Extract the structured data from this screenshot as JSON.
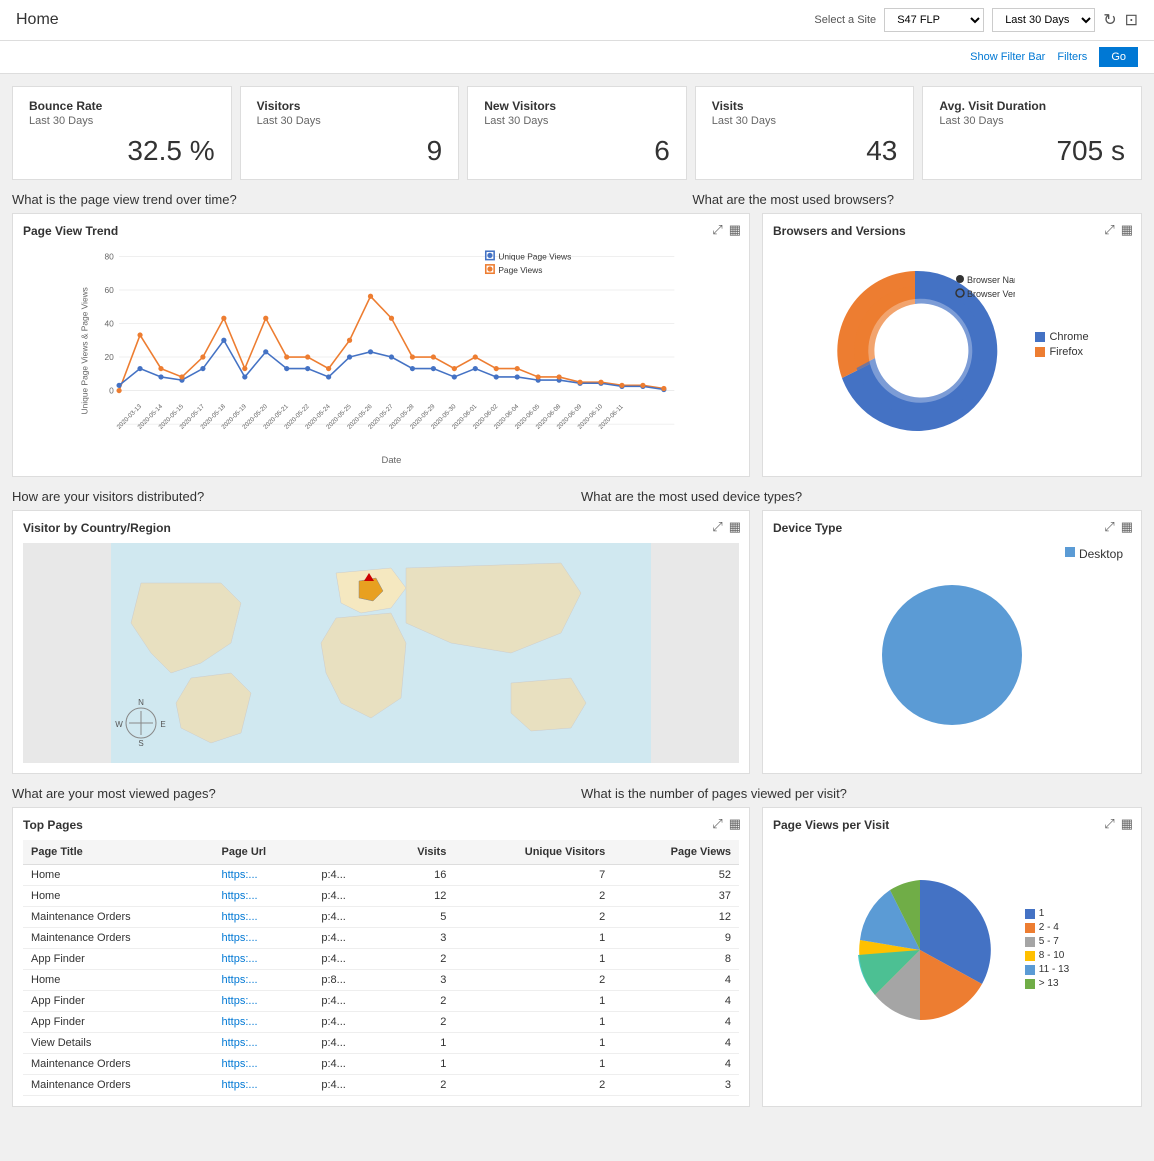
{
  "header": {
    "title": "Home",
    "site_label": "Select a Site",
    "site_value": "S47 FLP",
    "period_value": "Last 30 Days",
    "refresh_icon": "↻",
    "camera_icon": "📷"
  },
  "filter_bar": {
    "show_filter_bar_label": "Show Filter Bar",
    "filters_label": "Filters",
    "go_label": "Go"
  },
  "stats": [
    {
      "title": "Bounce Rate",
      "subtitle": "Last 30 Days",
      "value": "32.5 %"
    },
    {
      "title": "Visitors",
      "subtitle": "Last 30 Days",
      "value": "9"
    },
    {
      "title": "New Visitors",
      "subtitle": "Last 30 Days",
      "value": "6"
    },
    {
      "title": "Visits",
      "subtitle": "Last 30 Days",
      "value": "43"
    },
    {
      "title": "Avg. Visit Duration",
      "subtitle": "Last 30 Days",
      "value": "705 s"
    }
  ],
  "sections": {
    "page_view_question": "What is the page view trend over time?",
    "browsers_question": "What are the most used browsers?",
    "visitors_dist_question": "How are your visitors distributed?",
    "device_type_question": "What are the most used device types?",
    "most_viewed_question": "What are your most viewed pages?",
    "pages_per_visit_question": "What is the number of pages viewed per visit?"
  },
  "page_view_trend": {
    "title": "Page View Trend",
    "y_label": "Unique Page Views & Page Views",
    "x_label": "Date",
    "legend": [
      {
        "label": "Unique Page Views",
        "color": "#4472C4"
      },
      {
        "label": "Page Views",
        "color": "#ED7D31"
      }
    ]
  },
  "browsers": {
    "title": "Browsers and Versions",
    "legend_titles": [
      "Browser Name",
      "Browser Version"
    ],
    "items": [
      {
        "label": "Chrome",
        "color": "#4472C4",
        "value": 65
      },
      {
        "label": "Firefox",
        "color": "#ED7D31",
        "value": 35
      }
    ]
  },
  "map": {
    "title": "Visitor by Country/Region"
  },
  "device_type": {
    "title": "Device Type",
    "items": [
      {
        "label": "Desktop",
        "color": "#5B9BD5",
        "value": 100
      }
    ]
  },
  "top_pages": {
    "title": "Top Pages",
    "columns": [
      "Page Title",
      "Page Url",
      "",
      "Visits",
      "Unique Visitors",
      "Page Views"
    ],
    "rows": [
      {
        "title": "Home",
        "url": "https:...",
        "param": "p:4...",
        "visits": 16,
        "unique": 7,
        "pageviews": 52
      },
      {
        "title": "Home",
        "url": "https:...",
        "param": "p:4...",
        "visits": 12,
        "unique": 2,
        "pageviews": 37
      },
      {
        "title": "Maintenance Orders",
        "url": "https:...",
        "param": "p:4...",
        "visits": 5,
        "unique": 2,
        "pageviews": 12
      },
      {
        "title": "Maintenance Orders",
        "url": "https:...",
        "param": "p:4...",
        "visits": 3,
        "unique": 1,
        "pageviews": 9
      },
      {
        "title": "App Finder",
        "url": "https:...",
        "param": "p:4...",
        "visits": 2,
        "unique": 1,
        "pageviews": 8
      },
      {
        "title": "Home",
        "url": "https:...",
        "param": "p:8...",
        "visits": 3,
        "unique": 2,
        "pageviews": 4
      },
      {
        "title": "App Finder",
        "url": "https:...",
        "param": "p:4...",
        "visits": 2,
        "unique": 1,
        "pageviews": 4
      },
      {
        "title": "App Finder",
        "url": "https:...",
        "param": "p:4...",
        "visits": 2,
        "unique": 1,
        "pageviews": 4
      },
      {
        "title": "View Details",
        "url": "https:...",
        "param": "p:4...",
        "visits": 1,
        "unique": 1,
        "pageviews": 4
      },
      {
        "title": "Maintenance Orders",
        "url": "https:...",
        "param": "p:4...",
        "visits": 1,
        "unique": 1,
        "pageviews": 4
      },
      {
        "title": "Maintenance Orders",
        "url": "https:...",
        "param": "p:4...",
        "visits": 2,
        "unique": 2,
        "pageviews": 3
      }
    ]
  },
  "page_views_per_visit": {
    "title": "Page Views per Visit",
    "legend": [
      {
        "label": "1",
        "color": "#4472C4"
      },
      {
        "label": "2 - 4",
        "color": "#ED7D31"
      },
      {
        "label": "5 - 7",
        "color": "#A5A5A5"
      },
      {
        "label": "8 - 10",
        "color": "#FFC000"
      },
      {
        "label": "11 - 13",
        "color": "#5B9BD5"
      },
      {
        "label": "> 13",
        "color": "#70AD47"
      }
    ]
  }
}
